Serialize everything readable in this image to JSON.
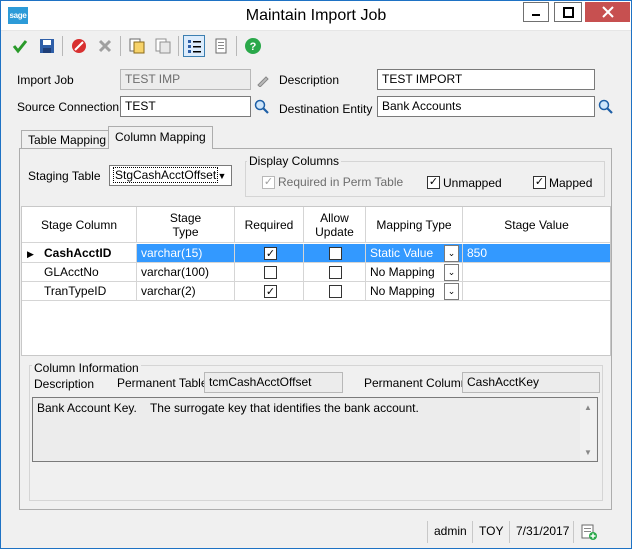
{
  "window": {
    "logo": "sage",
    "title": "Maintain Import Job"
  },
  "form": {
    "import_job_label": "Import Job",
    "import_job_value": "TEST IMP",
    "description_label": "Description",
    "description_value": "TEST IMPORT",
    "source_label": "Source Connection",
    "source_value": "TEST",
    "dest_label": "Destination Entity",
    "dest_value": "Bank Accounts"
  },
  "tabs": [
    "Table Mapping",
    "Column Mapping"
  ],
  "mapping": {
    "staging_table_label": "Staging Table",
    "staging_table_value": "StgCashAcctOffset",
    "display_columns_label": "Display Columns",
    "opt_required": "Required in Perm Table",
    "opt_unmapped": "Unmapped",
    "opt_mapped": "Mapped",
    "opt_required_checked": true,
    "opt_unmapped_checked": true,
    "opt_mapped_checked": true
  },
  "grid": {
    "headers": [
      "Stage Column",
      "Stage\nType",
      "Required",
      "Allow\nUpdate",
      "Mapping Type",
      "Stage Value"
    ],
    "rows": [
      {
        "column": "CashAcctID",
        "type": "varchar(15)",
        "required": true,
        "allow_update": false,
        "mapping": "Static Value",
        "value": "850"
      },
      {
        "column": "GLAcctNo",
        "type": "varchar(100)",
        "required": false,
        "allow_update": false,
        "mapping": "No Mapping",
        "value": ""
      },
      {
        "column": "TranTypeID",
        "type": "varchar(2)",
        "required": true,
        "allow_update": false,
        "mapping": "No Mapping",
        "value": ""
      }
    ]
  },
  "info": {
    "title": "Column Information",
    "description_label": "Description",
    "perm_table_label": "Permanent Table",
    "perm_table_value": "tcmCashAcctOffset",
    "perm_column_label": "Permanent Column",
    "perm_column_value": "CashAcctKey",
    "description_text": "Bank Account Key.    The surrogate key that identifies the bank account."
  },
  "status": {
    "user": "admin",
    "company": "TOY",
    "date": "7/31/2017"
  },
  "colors": {
    "accent": "#3399ff",
    "close": "#c75050",
    "brand": "#2d9bd8"
  }
}
